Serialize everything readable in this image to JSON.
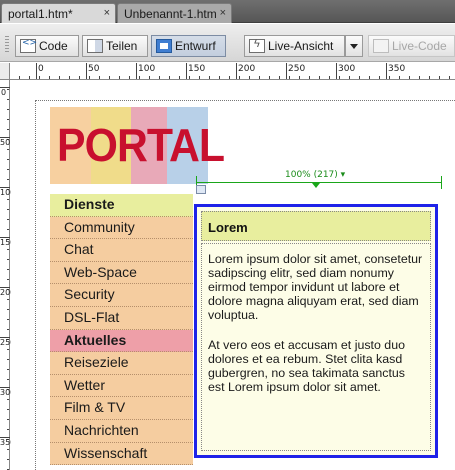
{
  "tabs": [
    {
      "label": "portal1.htm*",
      "close": "×"
    },
    {
      "label": "Unbenannt-1.htm",
      "close": "×"
    }
  ],
  "toolbar": {
    "code_label": "Code",
    "split_label": "Teilen",
    "design_label": "Entwurf",
    "live_view_label": "Live-Ansicht",
    "live_code_label": "Live-Code"
  },
  "ruler": {
    "h_labels": [
      "0",
      "50",
      "100",
      "150",
      "200",
      "250",
      "300",
      "350"
    ],
    "v_labels": [
      "0",
      "50",
      "100",
      "150",
      "200",
      "250",
      "300",
      "350"
    ]
  },
  "logo": {
    "text": "PORTAL",
    "block_colors": [
      "#f7d0a0",
      "#f0dc8a",
      "#e8a9b8",
      "#b8d0e8"
    ]
  },
  "nav": {
    "items": [
      {
        "label": "Dienste",
        "type": "section",
        "color": "#e8ee9e"
      },
      {
        "label": "Community",
        "type": "item",
        "color": "#f5cda0"
      },
      {
        "label": "Chat",
        "type": "item",
        "color": "#f5cda0"
      },
      {
        "label": "Web-Space",
        "type": "item",
        "color": "#f5cda0"
      },
      {
        "label": "Security",
        "type": "item",
        "color": "#f5cda0"
      },
      {
        "label": "DSL-Flat",
        "type": "item",
        "color": "#f5cda0"
      },
      {
        "label": "Aktuelles",
        "type": "section",
        "color": "#ee9fa8"
      },
      {
        "label": "Reiseziele",
        "type": "item",
        "color": "#f5cda0"
      },
      {
        "label": "Wetter",
        "type": "item",
        "color": "#f5cda0"
      },
      {
        "label": "Film & TV",
        "type": "item",
        "color": "#f5cda0"
      },
      {
        "label": "Nachrichten",
        "type": "item",
        "color": "#f5cda0"
      },
      {
        "label": "Wissenschaft",
        "type": "item",
        "color": "#f5cda0"
      }
    ]
  },
  "width_indicator": {
    "label": "100% (217) ▾"
  },
  "content": {
    "heading": "Lorem",
    "paragraph1": "Lorem ipsum dolor sit amet, consetetur sadipscing elitr, sed diam nonumy eirmod tempor invidunt ut labore et dolore magna aliquyam erat, sed diam voluptua.",
    "paragraph2": "At vero eos et accusam et justo duo dolores et ea rebum. Stet clita kasd gubergren, no sea takimata sanctus est Lorem ipsum dolor sit amet."
  },
  "colors": {
    "selection_border": "#1e22e8",
    "content_bg": "#fdfde7",
    "heading_bg": "#e8ee9e",
    "logo_text": "#c8102e",
    "width_guide": "#1aa61a"
  }
}
